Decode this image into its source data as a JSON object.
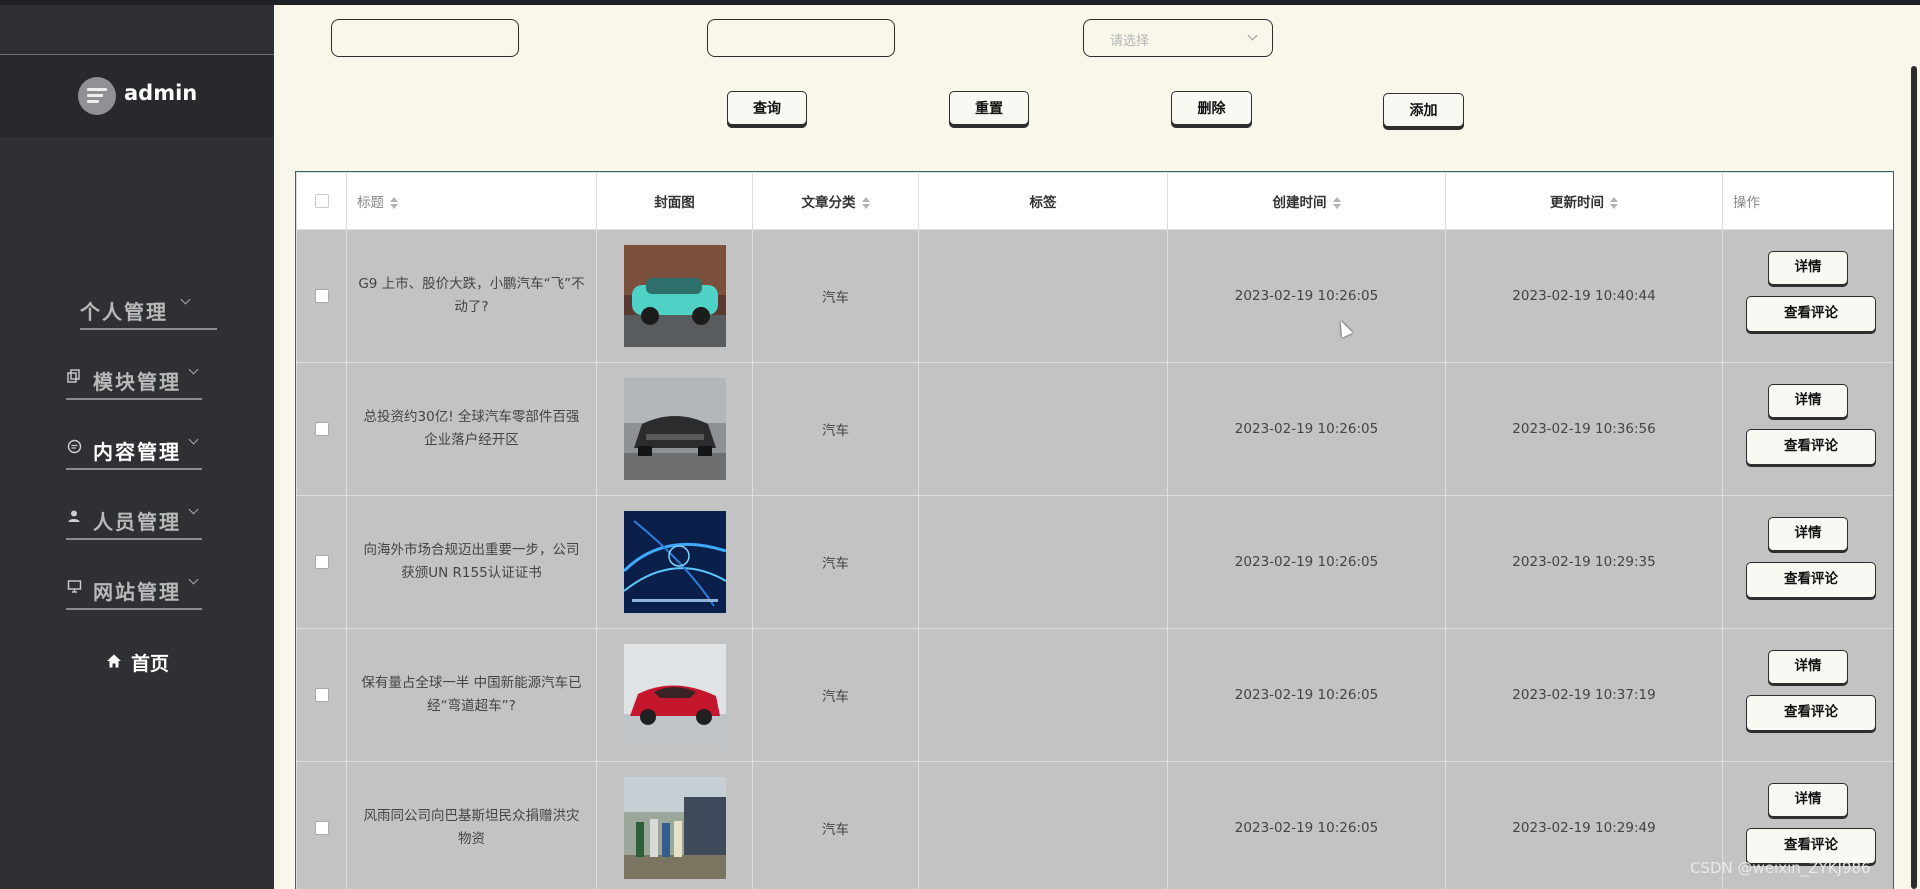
{
  "user": {
    "name": "admin"
  },
  "sidebar": {
    "items": [
      {
        "label": "个人管理",
        "icon": "none"
      },
      {
        "label": "模块管理",
        "icon": "copy-icon"
      },
      {
        "label": "内容管理",
        "icon": "chat-icon"
      },
      {
        "label": "人员管理",
        "icon": "user-icon"
      },
      {
        "label": "网站管理",
        "icon": "monitor-icon"
      }
    ],
    "home": "首页"
  },
  "filters": {
    "select_placeholder": "请选择"
  },
  "toolbar": {
    "query": "查询",
    "reset": "重置",
    "delete": "删除",
    "add": "添加"
  },
  "table": {
    "headers": {
      "title": "标题",
      "cover": "封面图",
      "category": "文章分类",
      "tags": "标签",
      "created": "创建时间",
      "updated": "更新时间",
      "actions": "操作"
    },
    "rows": [
      {
        "title": "G9 上市、股价大跌，小鹏汽车“飞”不动了?",
        "category": "汽车",
        "tags": "",
        "created": "2023-02-19 10:26:05",
        "updated": "2023-02-19 10:40:44",
        "cover": "teal-suv"
      },
      {
        "title": "总投资约30亿! 全球汽车零部件百强企业落户经开区",
        "category": "汽车",
        "tags": "",
        "created": "2023-02-19 10:26:05",
        "updated": "2023-02-19 10:36:56",
        "cover": "dark-sportscar"
      },
      {
        "title": "向海外市场合规迈出重要一步，公司获颁UN R155认证证书",
        "category": "汽车",
        "tags": "",
        "created": "2023-02-19 10:26:05",
        "updated": "2023-02-19 10:29:35",
        "cover": "blue-network"
      },
      {
        "title": "保有量占全球一半 中国新能源汽车已经“弯道超车”?",
        "category": "汽车",
        "tags": "",
        "created": "2023-02-19 10:26:05",
        "updated": "2023-02-19 10:37:19",
        "cover": "red-concept-car"
      },
      {
        "title": "风雨同公司向巴基斯坦民众捐赠洪灾物资",
        "category": "汽车",
        "tags": "",
        "created": "2023-02-19 10:26:05",
        "updated": "2023-02-19 10:29:49",
        "cover": "donation-photo"
      }
    ],
    "action_detail": "详情",
    "action_comments": "查看评论"
  },
  "watermark": "CSDN @weixin_ZYKJ986"
}
